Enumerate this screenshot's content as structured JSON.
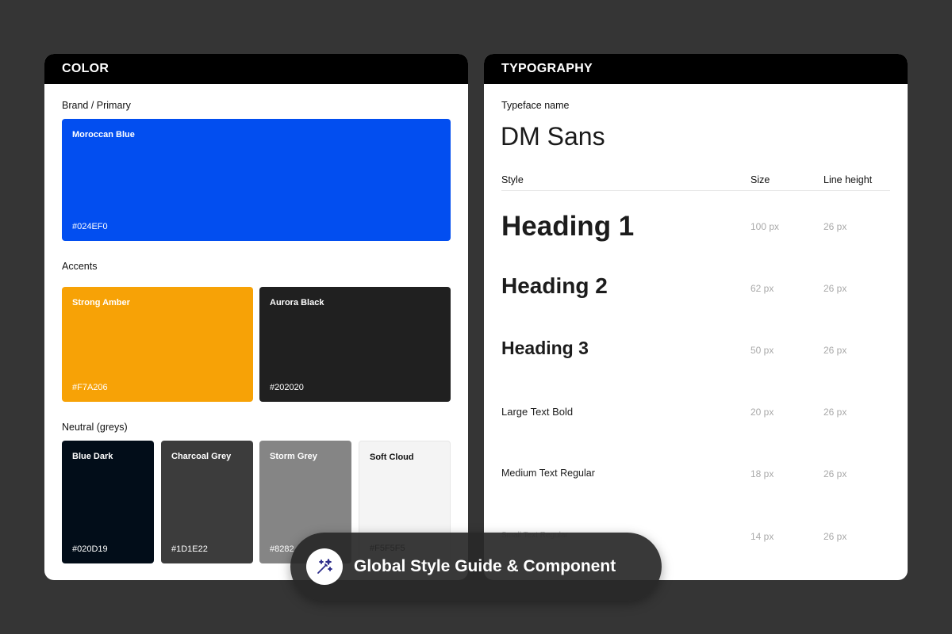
{
  "color_panel": {
    "title": "COLOR",
    "brand_label": "Brand / Primary",
    "brand": {
      "name": "Moroccan Blue",
      "hex": "#024EF0",
      "color": "#024EF0"
    },
    "accents_label": "Accents",
    "accents": [
      {
        "name": "Strong Amber",
        "hex": "#F7A206",
        "color": "#F7A206"
      },
      {
        "name": "Aurora Black",
        "hex": "#202020",
        "color": "#202020"
      }
    ],
    "neutral_label": "Neutral (greys)",
    "neutrals": [
      {
        "name": "Blue Dark",
        "hex": "#020D19",
        "color": "#020D19"
      },
      {
        "name": "Charcoal Grey",
        "hex": "#1D1E22",
        "color": "#3C3C3C"
      },
      {
        "name": "Storm Grey",
        "hex": "#8282",
        "color": "#858585"
      },
      {
        "name": "Soft Cloud",
        "hex": "#F5F5F5",
        "color": "#F4F4F4"
      }
    ]
  },
  "typography_panel": {
    "title": "TYPOGRAPHY",
    "typeface_label": "Typeface name",
    "typeface_name": "DM Sans",
    "columns": {
      "style": "Style",
      "size": "Size",
      "line_height": "Line height"
    },
    "rows": [
      {
        "style": "Heading 1",
        "size": "100 px",
        "line_height": "26 px"
      },
      {
        "style": "Heading 2",
        "size": "62 px",
        "line_height": "26 px"
      },
      {
        "style": "Heading 3",
        "size": "50 px",
        "line_height": "26 px"
      },
      {
        "style": "Large Text Bold",
        "size": "20 px",
        "line_height": "26 px"
      },
      {
        "style": "Medium Text Regular",
        "size": "18 px",
        "line_height": "26 px"
      },
      {
        "style": "Small Text Regular",
        "size": "14 px",
        "line_height": "26 px"
      }
    ]
  },
  "banner": {
    "text": "Global Style Guide & Component",
    "icon": "magic-wand-icon"
  }
}
